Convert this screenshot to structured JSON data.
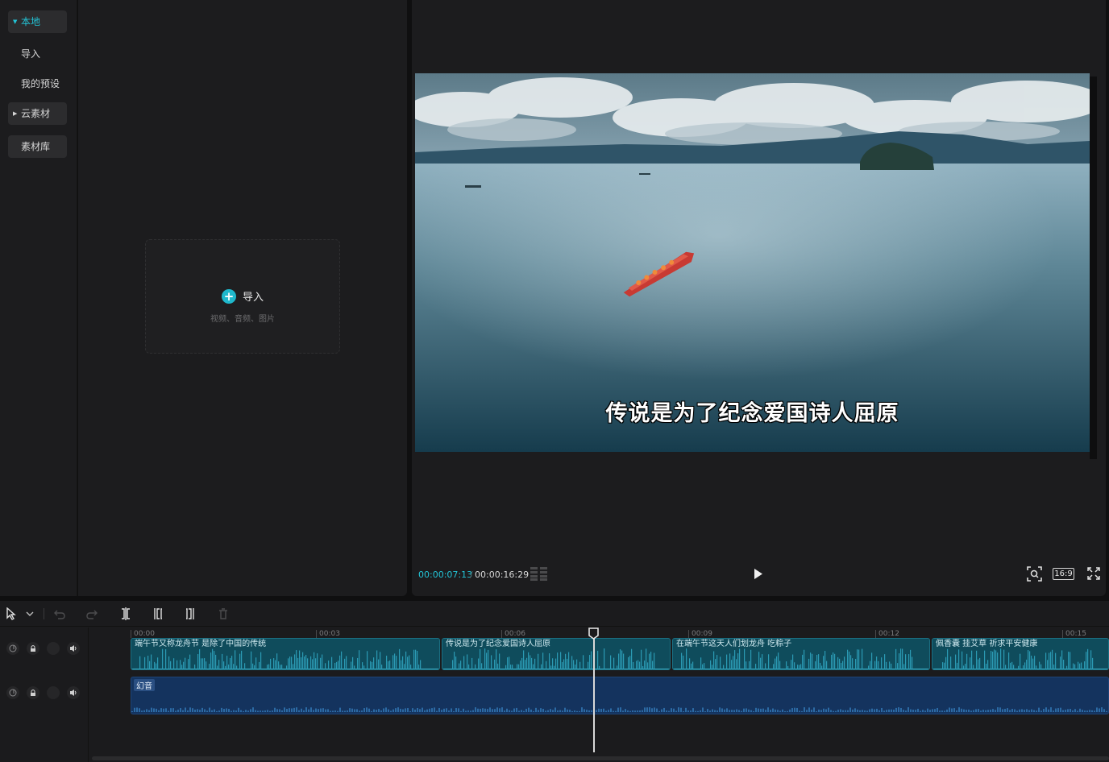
{
  "sidebar": {
    "local": "本地",
    "import": "导入",
    "presets": "我的预设",
    "cloud": "云素材",
    "library": "素材库"
  },
  "media": {
    "import_label": "导入",
    "import_sub": "视频、音频、图片"
  },
  "player": {
    "subtitle": "传说是为了纪念爱国诗人屈原",
    "current_time": "00:00:07:13",
    "separator": "/",
    "total_time": "00:00:16:29",
    "ratio": "16:9"
  },
  "timeline": {
    "ticks": [
      "00:00",
      "00:03",
      "00:06",
      "00:09",
      "00:12",
      "00:15"
    ],
    "clips": [
      {
        "title": "端午节又称龙舟节 是除了中国的传统"
      },
      {
        "title": "传说是为了纪念爱国诗人屈原"
      },
      {
        "title": "在端午节这天人们划龙舟 吃粽子"
      },
      {
        "title": "佩香囊 挂艾草 祈求平安健康"
      }
    ],
    "music_label": "幻音"
  },
  "colors": {
    "accent": "#23c4d6",
    "clip": "#0f4c5c",
    "music": "#14335e"
  }
}
